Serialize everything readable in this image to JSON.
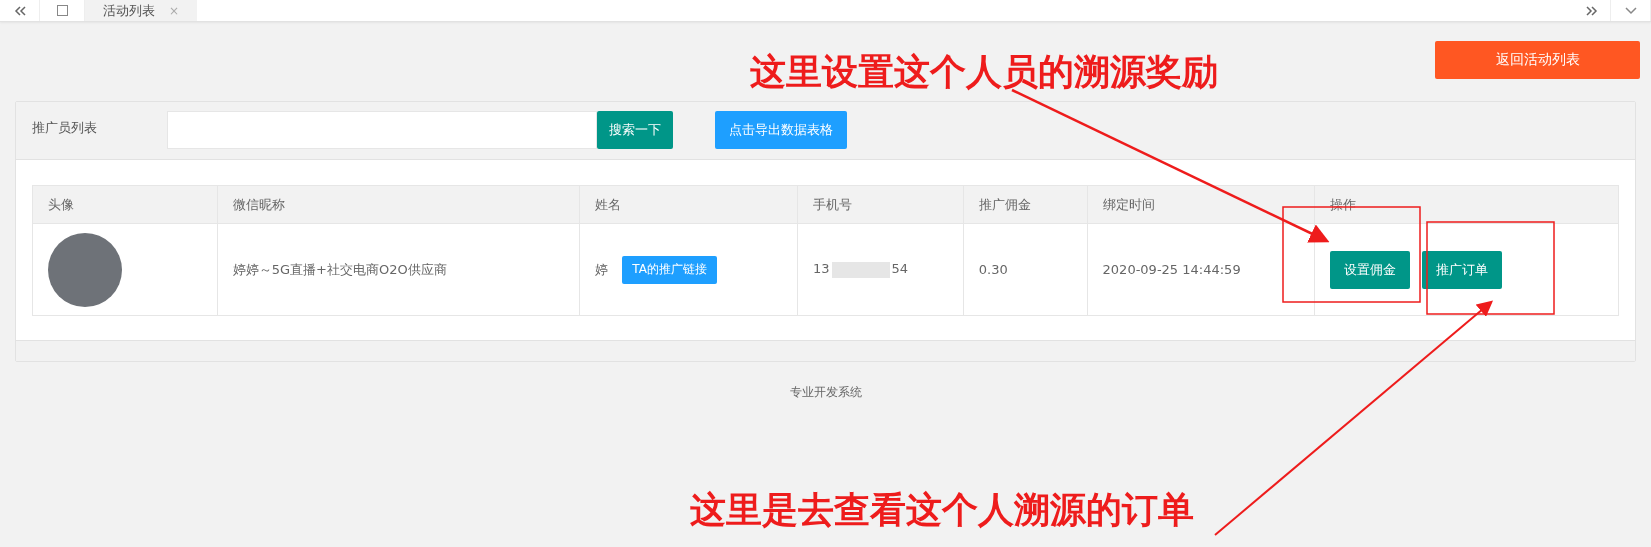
{
  "top_tabs": [
    {
      "label": "活动列表",
      "close": "×",
      "selected": true
    }
  ],
  "return_button": "返回活动列表",
  "panel": {
    "title": "推广员列表",
    "search_button": "搜索一下",
    "export_button": "点击导出数据表格"
  },
  "table": {
    "columns": [
      "头像",
      "微信昵称",
      "姓名",
      "手机号",
      "推广佣金",
      "绑定时间",
      "操作"
    ],
    "rows": [
      {
        "nickname": "婷婷～5G直播+社交电商O2O供应商",
        "name": "婷",
        "link_button": "TA的推广链接",
        "phone_start": "13",
        "phone_end": "54",
        "commission": "0.30",
        "bound_time": "2020-09-25 14:44:59",
        "actions": [
          "设置佣金",
          "推广订单"
        ]
      }
    ]
  },
  "footer": "专业开发系统",
  "annotations": [
    {
      "text": "这里设置这个人员的溯源奖励"
    },
    {
      "text": "这里是去查看这个人溯源的订单"
    }
  ]
}
